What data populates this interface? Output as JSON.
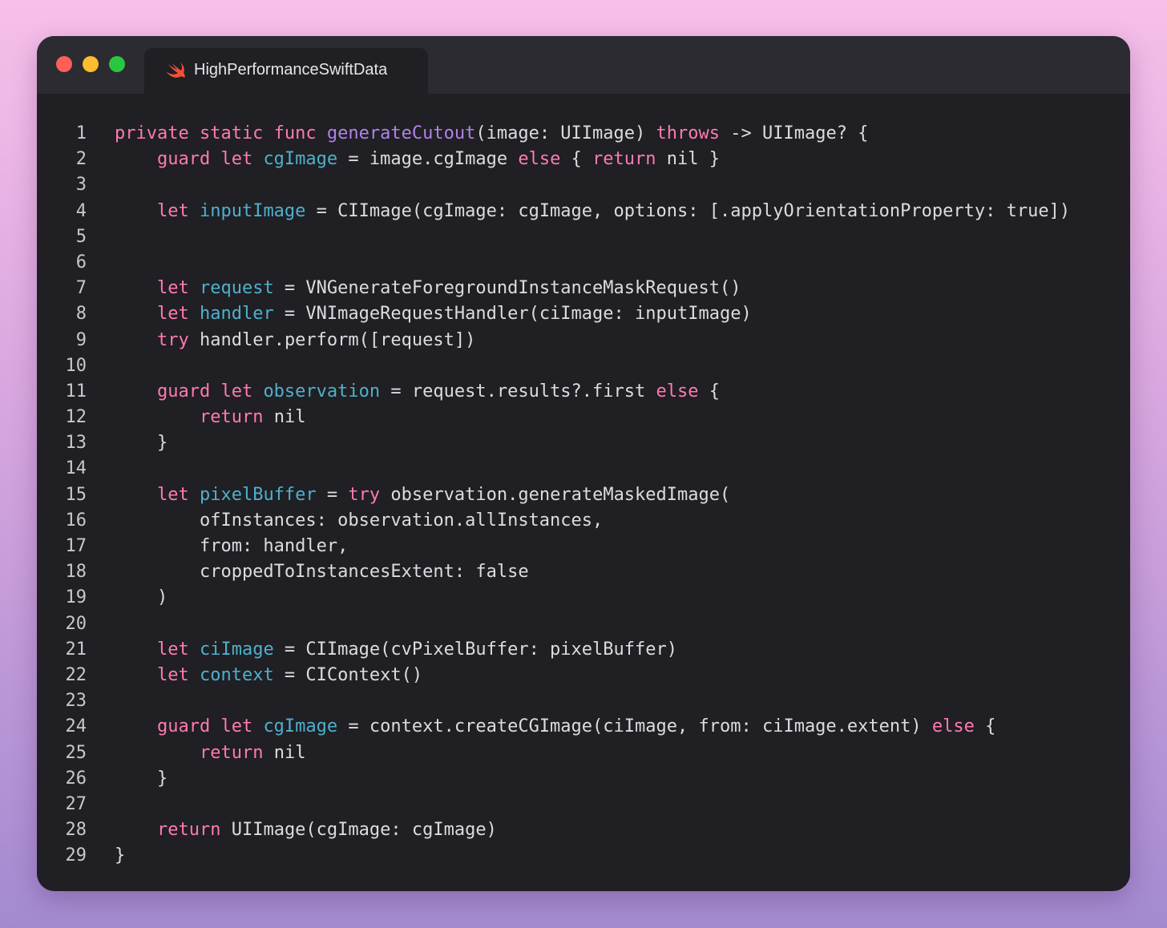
{
  "window": {
    "tab_title": "HighPerformanceSwiftData",
    "tab_icon": "swift-icon",
    "traffic_lights": {
      "close": "#fe5f57",
      "minimize": "#febc2e",
      "zoom": "#27c840"
    }
  },
  "colors": {
    "keyword": "#ff7ab2",
    "declaration": "#4fb0cc",
    "function": "#b281eb",
    "text": "#dcdce0",
    "background": "#1f1f24"
  },
  "code": {
    "lines": [
      {
        "n": "1",
        "tokens": [
          [
            "k",
            "private static func "
          ],
          [
            "f",
            "generateCutout"
          ],
          [
            "t",
            "(image: UIImage) "
          ],
          [
            "k",
            "throws"
          ],
          [
            "t",
            " -> UIImage? {"
          ]
        ]
      },
      {
        "n": "2",
        "tokens": [
          [
            "t",
            "    "
          ],
          [
            "k",
            "guard let "
          ],
          [
            "n",
            "cgImage"
          ],
          [
            "t",
            " = image.cgImage "
          ],
          [
            "k",
            "else"
          ],
          [
            "t",
            " { "
          ],
          [
            "k",
            "return"
          ],
          [
            "t",
            " nil }"
          ]
        ]
      },
      {
        "n": "3",
        "tokens": []
      },
      {
        "n": "4",
        "tokens": [
          [
            "t",
            "    "
          ],
          [
            "k",
            "let "
          ],
          [
            "n",
            "inputImage"
          ],
          [
            "t",
            " = CIImage(cgImage: cgImage, options: [.applyOrientationProperty: true])"
          ]
        ]
      },
      {
        "n": "5",
        "tokens": []
      },
      {
        "n": "6",
        "tokens": []
      },
      {
        "n": "7",
        "tokens": [
          [
            "t",
            "    "
          ],
          [
            "k",
            "let "
          ],
          [
            "n",
            "request"
          ],
          [
            "t",
            " = VNGenerateForegroundInstanceMaskRequest()"
          ]
        ]
      },
      {
        "n": "8",
        "tokens": [
          [
            "t",
            "    "
          ],
          [
            "k",
            "let "
          ],
          [
            "n",
            "handler"
          ],
          [
            "t",
            " = VNImageRequestHandler(ciImage: inputImage)"
          ]
        ]
      },
      {
        "n": "9",
        "tokens": [
          [
            "t",
            "    "
          ],
          [
            "k",
            "try"
          ],
          [
            "t",
            " handler.perform([request])"
          ]
        ]
      },
      {
        "n": "10",
        "tokens": []
      },
      {
        "n": "11",
        "tokens": [
          [
            "t",
            "    "
          ],
          [
            "k",
            "guard let "
          ],
          [
            "n",
            "observation"
          ],
          [
            "t",
            " = request.results?.first "
          ],
          [
            "k",
            "else"
          ],
          [
            "t",
            " {"
          ]
        ]
      },
      {
        "n": "12",
        "tokens": [
          [
            "t",
            "        "
          ],
          [
            "k",
            "return"
          ],
          [
            "t",
            " nil"
          ]
        ]
      },
      {
        "n": "13",
        "tokens": [
          [
            "t",
            "    }"
          ]
        ]
      },
      {
        "n": "14",
        "tokens": []
      },
      {
        "n": "15",
        "tokens": [
          [
            "t",
            "    "
          ],
          [
            "k",
            "let "
          ],
          [
            "n",
            "pixelBuffer"
          ],
          [
            "t",
            " = "
          ],
          [
            "k",
            "try"
          ],
          [
            "t",
            " observation.generateMaskedImage("
          ]
        ]
      },
      {
        "n": "16",
        "tokens": [
          [
            "t",
            "        ofInstances: observation.allInstances,"
          ]
        ]
      },
      {
        "n": "17",
        "tokens": [
          [
            "t",
            "        from: handler,"
          ]
        ]
      },
      {
        "n": "18",
        "tokens": [
          [
            "t",
            "        croppedToInstancesExtent: false"
          ]
        ]
      },
      {
        "n": "19",
        "tokens": [
          [
            "t",
            "    )"
          ]
        ]
      },
      {
        "n": "20",
        "tokens": []
      },
      {
        "n": "21",
        "tokens": [
          [
            "t",
            "    "
          ],
          [
            "k",
            "let "
          ],
          [
            "n",
            "ciImage"
          ],
          [
            "t",
            " = CIImage(cvPixelBuffer: pixelBuffer)"
          ]
        ]
      },
      {
        "n": "22",
        "tokens": [
          [
            "t",
            "    "
          ],
          [
            "k",
            "let "
          ],
          [
            "n",
            "context"
          ],
          [
            "t",
            " = CIContext()"
          ]
        ]
      },
      {
        "n": "23",
        "tokens": []
      },
      {
        "n": "24",
        "tokens": [
          [
            "t",
            "    "
          ],
          [
            "k",
            "guard let "
          ],
          [
            "n",
            "cgImage"
          ],
          [
            "t",
            " = context.createCGImage(ciImage, from: ciImage.extent) "
          ],
          [
            "k",
            "else"
          ],
          [
            "t",
            " {"
          ]
        ]
      },
      {
        "n": "25",
        "tokens": [
          [
            "t",
            "        "
          ],
          [
            "k",
            "return"
          ],
          [
            "t",
            " nil"
          ]
        ]
      },
      {
        "n": "26",
        "tokens": [
          [
            "t",
            "    }"
          ]
        ]
      },
      {
        "n": "27",
        "tokens": []
      },
      {
        "n": "28",
        "tokens": [
          [
            "t",
            "    "
          ],
          [
            "k",
            "return"
          ],
          [
            "t",
            " UIImage(cgImage: cgImage)"
          ]
        ]
      },
      {
        "n": "29",
        "tokens": [
          [
            "t",
            "}"
          ]
        ]
      }
    ]
  }
}
